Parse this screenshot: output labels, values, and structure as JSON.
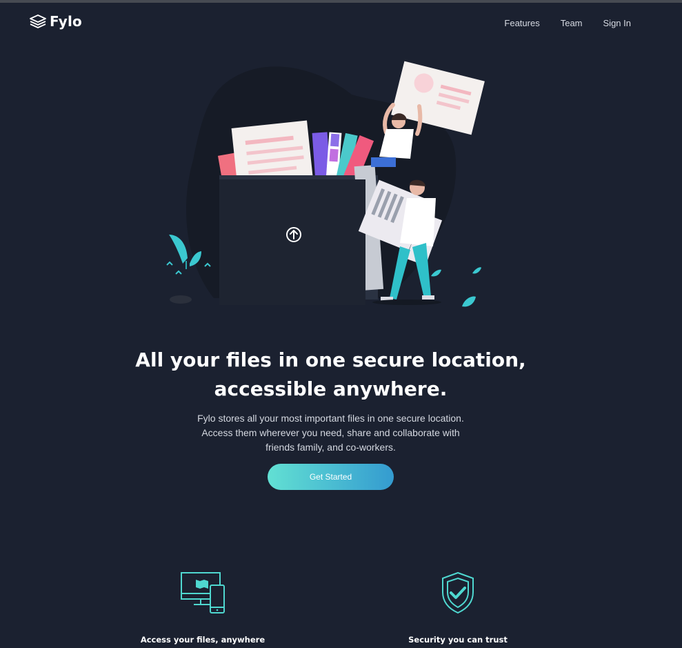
{
  "brand": {
    "name": "Fylo",
    "logo_icon": "stacked-layers-icon"
  },
  "nav": {
    "items": [
      "Features",
      "Team",
      "Sign In"
    ]
  },
  "hero": {
    "illustration": "file-upload-illustration",
    "headline_lines": [
      "All your files in one secure location,",
      "accessible anywhere."
    ],
    "description_lines": [
      "Fylo stores all your most important files in one secure location.",
      "Access them wherever you need, share and collaborate with",
      "friends family, and co-workers."
    ],
    "cta_label": "Get Started"
  },
  "features": [
    {
      "title": "Access your files, anywhere",
      "icon": "devices-icon"
    },
    {
      "title": "Security you can trust",
      "icon": "shield-check-icon"
    }
  ],
  "colors": {
    "background": "#1b2130",
    "accent_start": "#62e0d3",
    "accent_end": "#349bd0",
    "icon_teal": "#4fd8d0"
  }
}
